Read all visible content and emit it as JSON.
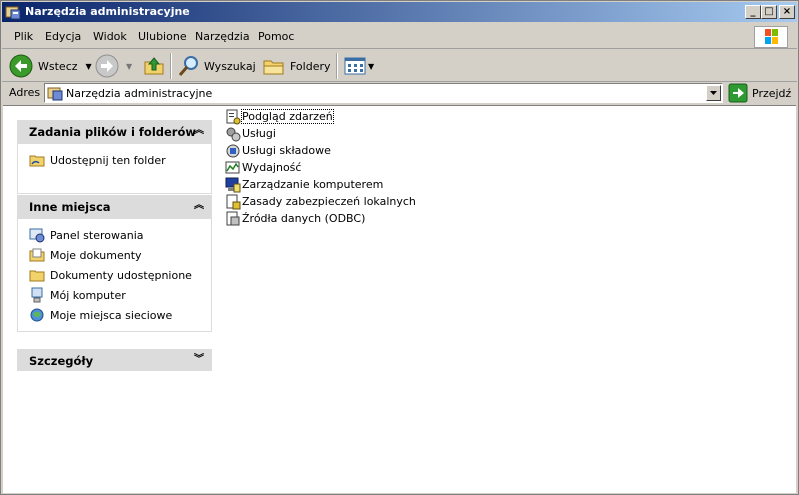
{
  "window": {
    "title": "Narzędzia administracyjne"
  },
  "menu": {
    "items": [
      "Plik",
      "Edycja",
      "Widok",
      "Ulubione",
      "Narzędzia",
      "Pomoc"
    ]
  },
  "toolbar": {
    "back": "Wstecz",
    "search": "Wyszukaj",
    "folders": "Foldery"
  },
  "address": {
    "label": "Adres",
    "value": "Narzędzia administracyjne",
    "go": "Przejdź"
  },
  "tasks_panel": {
    "title": "Zadania plików i folderów",
    "items": [
      "Udostępnij ten folder"
    ]
  },
  "places_panel": {
    "title": "Inne miejsca",
    "items": [
      "Panel sterowania",
      "Moje dokumenty",
      "Dokumenty udostępnione",
      "Mój komputer",
      "Moje miejsca sieciowe"
    ]
  },
  "details_panel": {
    "title": "Szczegóły"
  },
  "files": [
    "Podgląd zdarzeń",
    "Usługi",
    "Usługi składowe",
    "Wydajność",
    "Zarządzanie komputerem",
    "Zasady zabezpieczeń lokalnych",
    "Źródła danych (ODBC)"
  ],
  "colors": {
    "title_start": "#0a246a",
    "title_end": "#a6caf0",
    "back_green": "#3a9a2a",
    "go_green": "#2f9a32"
  }
}
